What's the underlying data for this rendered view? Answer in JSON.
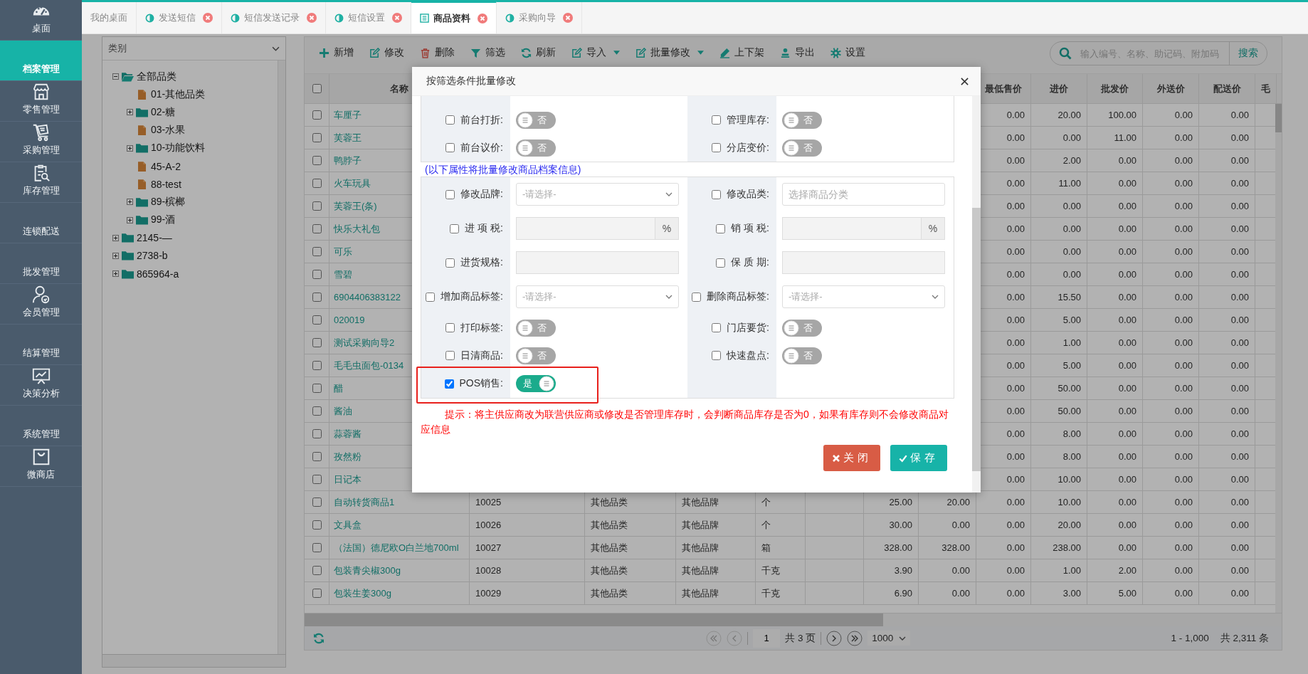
{
  "sidebar": {
    "items": [
      {
        "label": "桌面",
        "kind": "module",
        "selected": false
      },
      {
        "label": "档案管理",
        "kind": "group",
        "selected": true
      },
      {
        "label": "零售管理",
        "kind": "module",
        "selected": false
      },
      {
        "label": "采购管理",
        "kind": "module",
        "selected": false
      },
      {
        "label": "库存管理",
        "kind": "module",
        "selected": false
      },
      {
        "label": "连锁配送",
        "kind": "group",
        "selected": false
      },
      {
        "label": "批发管理",
        "kind": "group",
        "selected": false
      },
      {
        "label": "会员管理",
        "kind": "module",
        "selected": false
      },
      {
        "label": "结算管理",
        "kind": "group",
        "selected": false
      },
      {
        "label": "决策分析",
        "kind": "module",
        "selected": false
      },
      {
        "label": "系统管理",
        "kind": "group",
        "selected": false
      },
      {
        "label": "微商店",
        "kind": "module",
        "selected": false
      }
    ]
  },
  "tabs": [
    {
      "label": "我的桌面",
      "closable": false,
      "selected": false
    },
    {
      "label": "发送短信",
      "closable": true,
      "selected": false
    },
    {
      "label": "短信发送记录",
      "closable": true,
      "selected": false
    },
    {
      "label": "短信设置",
      "closable": true,
      "selected": false
    },
    {
      "label": "商品资料",
      "closable": true,
      "selected": true
    },
    {
      "label": "采购向导",
      "closable": true,
      "selected": false
    }
  ],
  "category_tree": {
    "select": "类别",
    "nodes": [
      {
        "label": "全部品类",
        "kind": "folder",
        "expanded": true,
        "children": [
          {
            "label": "01-其他品类",
            "kind": "file"
          },
          {
            "label": "02-糖",
            "kind": "folder",
            "expanded": false
          },
          {
            "label": "03-水果",
            "kind": "file"
          },
          {
            "label": "10-功能饮料",
            "kind": "folder",
            "expanded": false
          },
          {
            "label": "45-A-2",
            "kind": "file"
          },
          {
            "label": "88-test",
            "kind": "file"
          },
          {
            "label": "89-槟榔",
            "kind": "folder",
            "expanded": false
          },
          {
            "label": "99-酒",
            "kind": "folder",
            "expanded": false
          }
        ]
      },
      {
        "label": "2145-—",
        "kind": "folder",
        "expanded": false
      },
      {
        "label": "2738-b",
        "kind": "folder",
        "expanded": false
      },
      {
        "label": "865964-a",
        "kind": "folder",
        "expanded": false
      }
    ]
  },
  "toolbar": {
    "buttons": [
      {
        "label": "新增",
        "dropdown": false
      },
      {
        "label": "修改",
        "dropdown": false
      },
      {
        "label": "删除",
        "dropdown": false
      },
      {
        "label": "筛选",
        "dropdown": false
      },
      {
        "label": "刷新",
        "dropdown": false
      },
      {
        "label": "导入",
        "dropdown": true
      },
      {
        "label": "批量修改",
        "dropdown": true
      },
      {
        "label": "上下架",
        "dropdown": false
      },
      {
        "label": "导出",
        "dropdown": false
      },
      {
        "label": "设置",
        "dropdown": false
      }
    ],
    "search": {
      "placeholder": "输入编号、名称、助记码、附加码",
      "button": "搜索"
    }
  },
  "table": {
    "all_checked": false,
    "columns": [
      "名称",
      "最低售价",
      "进价",
      "批发价",
      "外送价",
      "配送价",
      "毛"
    ],
    "rows": [
      {
        "checked": false,
        "name": "车厘子",
        "lowest_price": "0.00",
        "purchase_price": "20.00",
        "wholesale_price": "100.00",
        "outside_delivery_price": "0.00",
        "distribution_price": "0.00"
      },
      {
        "checked": false,
        "name": "芙蓉王",
        "lowest_price": "0.00",
        "purchase_price": "0.00",
        "wholesale_price": "11.00",
        "outside_delivery_price": "0.00",
        "distribution_price": "0.00"
      },
      {
        "checked": false,
        "name": "鸭脖子",
        "lowest_price": "0.00",
        "purchase_price": "2.00",
        "wholesale_price": "0.00",
        "outside_delivery_price": "0.00",
        "distribution_price": "0.00"
      },
      {
        "checked": false,
        "name": "火车玩具",
        "lowest_price": "0.00",
        "purchase_price": "11.00",
        "wholesale_price": "0.00",
        "outside_delivery_price": "0.00",
        "distribution_price": "0.00"
      },
      {
        "checked": false,
        "name": "芙蓉王(条)",
        "lowest_price": "0.00",
        "purchase_price": "0.00",
        "wholesale_price": "0.00",
        "outside_delivery_price": "0.00",
        "distribution_price": "0.00"
      },
      {
        "checked": false,
        "name": "快乐大礼包",
        "lowest_price": "0.00",
        "purchase_price": "0.00",
        "wholesale_price": "0.00",
        "outside_delivery_price": "0.00",
        "distribution_price": "0.00"
      },
      {
        "checked": false,
        "name": "可乐",
        "lowest_price": "0.00",
        "purchase_price": "0.00",
        "wholesale_price": "0.00",
        "outside_delivery_price": "0.00",
        "distribution_price": "0.00"
      },
      {
        "checked": false,
        "name": "雪碧",
        "lowest_price": "0.00",
        "purchase_price": "0.00",
        "wholesale_price": "0.00",
        "outside_delivery_price": "0.00",
        "distribution_price": "0.00"
      },
      {
        "checked": false,
        "name": "6904406383122",
        "lowest_price": "0.00",
        "purchase_price": "15.50",
        "wholesale_price": "0.00",
        "outside_delivery_price": "0.00",
        "distribution_price": "0.00"
      },
      {
        "checked": false,
        "name": "020019",
        "lowest_price": "0.00",
        "purchase_price": "5.00",
        "wholesale_price": "0.00",
        "outside_delivery_price": "0.00",
        "distribution_price": "0.00"
      },
      {
        "checked": false,
        "name": "测试采购向导2",
        "lowest_price": "0.00",
        "purchase_price": "1.00",
        "wholesale_price": "0.00",
        "outside_delivery_price": "0.00",
        "distribution_price": "0.00"
      },
      {
        "checked": false,
        "name": "毛毛虫面包-0134",
        "lowest_price": "0.00",
        "purchase_price": "5.00",
        "wholesale_price": "0.00",
        "outside_delivery_price": "0.00",
        "distribution_price": "0.00"
      },
      {
        "checked": false,
        "name": "醋",
        "lowest_price": "0.00",
        "purchase_price": "50.00",
        "wholesale_price": "0.00",
        "outside_delivery_price": "0.00",
        "distribution_price": "0.00"
      },
      {
        "checked": false,
        "name": "酱油",
        "lowest_price": "0.00",
        "purchase_price": "50.00",
        "wholesale_price": "0.00",
        "outside_delivery_price": "0.00",
        "distribution_price": "0.00"
      },
      {
        "checked": false,
        "name": "蒜蓉酱",
        "lowest_price": "0.00",
        "purchase_price": "8.00",
        "wholesale_price": "0.00",
        "outside_delivery_price": "0.00",
        "distribution_price": "0.00"
      },
      {
        "checked": false,
        "name": "孜然粉",
        "lowest_price": "0.00",
        "purchase_price": "8.00",
        "wholesale_price": "0.00",
        "outside_delivery_price": "0.00",
        "distribution_price": "0.00"
      },
      {
        "checked": false,
        "name": "日记本",
        "lowest_price": "0.00",
        "purchase_price": "10.00",
        "wholesale_price": "0.00",
        "outside_delivery_price": "0.00",
        "distribution_price": "0.00"
      },
      {
        "checked": false,
        "name": "自动转货商品1",
        "column_3": "10025",
        "column_4": "其他品类",
        "column_5": "其他品牌",
        "column_6": "个",
        "column_8": "25.00",
        "column_9": "20.00",
        "lowest_price": "0.00",
        "purchase_price": "10.00",
        "wholesale_price": "0.00",
        "outside_delivery_price": "0.00",
        "distribution_price": "0.00"
      },
      {
        "checked": false,
        "name": "文具盒",
        "column_3": "10026",
        "column_4": "其他品类",
        "column_5": "其他品牌",
        "column_6": "个",
        "column_8": "30.00",
        "column_9": "0.00",
        "lowest_price": "0.00",
        "purchase_price": "20.00",
        "wholesale_price": "0.00",
        "outside_delivery_price": "0.00",
        "distribution_price": "0.00"
      },
      {
        "checked": false,
        "name": "（法国）德尼欧O白兰地700ml",
        "column_3": "10027",
        "column_4": "其他品类",
        "column_5": "其他品牌",
        "column_6": "箱",
        "column_8": "328.00",
        "column_9": "328.00",
        "lowest_price": "0.00",
        "purchase_price": "238.00",
        "wholesale_price": "0.00",
        "outside_delivery_price": "0.00",
        "distribution_price": "0.00"
      },
      {
        "checked": false,
        "name": "包装青尖椒300g",
        "column_3": "10028",
        "column_4": "其他品类",
        "column_5": "其他品牌",
        "column_6": "千克",
        "column_8": "3.90",
        "column_9": "0.00",
        "lowest_price": "0.00",
        "purchase_price": "1.00",
        "wholesale_price": "2.00",
        "outside_delivery_price": "0.00",
        "distribution_price": "0.00"
      },
      {
        "checked": false,
        "name": "包装生姜300g",
        "column_3": "10029",
        "column_4": "其他品类",
        "column_5": "其他品牌",
        "column_6": "千克",
        "column_8": "6.90",
        "column_9": "0.00",
        "lowest_price": "0.00",
        "purchase_price": "3.00",
        "wholesale_price": "5.00",
        "outside_delivery_price": "0.00",
        "distribution_price": "0.00"
      }
    ]
  },
  "pager": {
    "page": "1",
    "total_pages": "共 3 页",
    "page_size": "1000",
    "range": "1 - 1,000",
    "total": "共 2,311 条"
  },
  "modal": {
    "title": "按筛选条件批量修改",
    "note": "(以下属性将批量修改商品档案信息)",
    "sections": [
      {
        "rows": [
          {
            "highlighted": false,
            "fields": [
              {
                "kind": "toggle",
                "label": "前台打折:",
                "checked": false,
                "on": false,
                "text": "否"
              },
              {
                "kind": "toggle",
                "label": "管理库存:",
                "checked": false,
                "on": false,
                "text": "否"
              }
            ]
          },
          {
            "highlighted": false,
            "fields": [
              {
                "kind": "toggle",
                "label": "前台议价:",
                "checked": false,
                "on": false,
                "text": "否"
              },
              {
                "kind": "toggle",
                "label": "分店变价:",
                "checked": false,
                "on": false,
                "text": "否"
              }
            ]
          }
        ]
      },
      {
        "rows": [
          {
            "highlighted": false,
            "fields": [
              {
                "kind": "select",
                "label": "修改品牌:",
                "checked": false,
                "placeholder": "-请选择-"
              },
              {
                "kind": "input",
                "label": "修改品类:",
                "checked": false,
                "disabled": false,
                "placeholder": "选择商品分类"
              }
            ]
          },
          {
            "highlighted": false,
            "fields": [
              {
                "kind": "input",
                "label": "进 项 税:",
                "checked": false,
                "disabled": true,
                "unit": "%"
              },
              {
                "kind": "input",
                "label": "销 项 税:",
                "checked": false,
                "disabled": true,
                "unit": "%"
              }
            ]
          },
          {
            "highlighted": false,
            "fields": [
              {
                "kind": "input",
                "label": "进货规格:",
                "checked": false,
                "disabled": true
              },
              {
                "kind": "input",
                "label": "保 质 期:",
                "checked": false,
                "disabled": true
              }
            ]
          },
          {
            "highlighted": false,
            "fields": [
              {
                "kind": "select",
                "label": "增加商品标签:",
                "checked": false,
                "placeholder": "-请选择-"
              },
              {
                "kind": "select",
                "label": "删除商品标签:",
                "checked": false,
                "placeholder": "-请选择-"
              }
            ]
          },
          {
            "highlighted": false,
            "fields": [
              {
                "kind": "toggle",
                "label": "打印标签:",
                "checked": false,
                "on": false,
                "text": "否"
              },
              {
                "kind": "toggle",
                "label": "门店要货:",
                "checked": false,
                "on": false,
                "text": "否"
              }
            ]
          },
          {
            "highlighted": false,
            "fields": [
              {
                "kind": "toggle",
                "label": "日清商品:",
                "checked": false,
                "on": false,
                "text": "否"
              },
              {
                "kind": "toggle",
                "label": "快速盘点:",
                "checked": false,
                "on": false,
                "text": "否"
              }
            ]
          },
          {
            "highlighted": true,
            "fields": [
              {
                "kind": "toggle",
                "label": "POS销售:",
                "checked": true,
                "on": true,
                "text": "是"
              }
            ]
          }
        ]
      }
    ],
    "tip": "提示：将主供应商改为联营供应商或修改是否管理库存时，会判断商品库存是否为0，如果有库存则不会修改商品对应信息",
    "buttons": [
      {
        "label": "关闭",
        "kind": "close"
      },
      {
        "label": "保存",
        "kind": "save"
      }
    ]
  }
}
